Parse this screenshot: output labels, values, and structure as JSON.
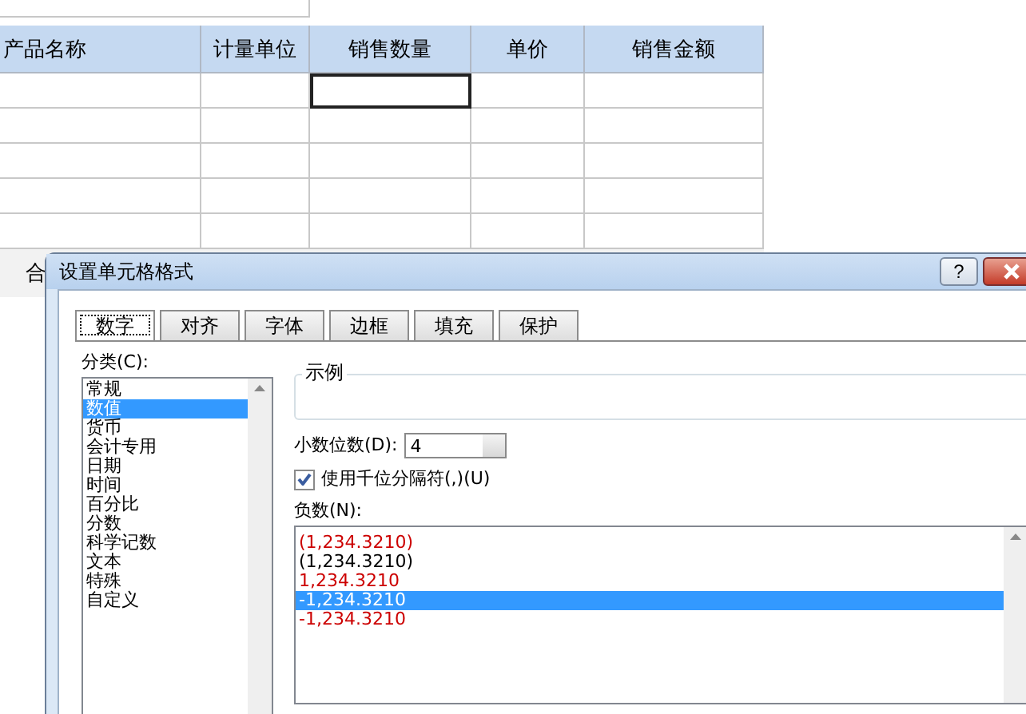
{
  "sheet": {
    "columns": [
      {
        "label": "产品名称"
      },
      {
        "label": "计量单位"
      },
      {
        "label": "销售数量"
      },
      {
        "label": "单价"
      },
      {
        "label": "销售金额"
      }
    ],
    "rows": [
      {
        "cells": [
          {
            "selected": false
          },
          {
            "selected": false
          },
          {
            "selected": true
          },
          {
            "selected": false
          },
          {
            "selected": false
          }
        ]
      },
      {
        "cells": [
          {
            "selected": false
          },
          {
            "selected": false
          },
          {
            "selected": false
          },
          {
            "selected": false
          },
          {
            "selected": false
          }
        ]
      },
      {
        "cells": [
          {
            "selected": false
          },
          {
            "selected": false
          },
          {
            "selected": false
          },
          {
            "selected": false
          },
          {
            "selected": false
          }
        ]
      },
      {
        "cells": [
          {
            "selected": false
          },
          {
            "selected": false
          },
          {
            "selected": false
          },
          {
            "selected": false
          },
          {
            "selected": false
          }
        ]
      },
      {
        "cells": [
          {
            "selected": false
          },
          {
            "selected": false
          },
          {
            "selected": false
          },
          {
            "selected": false
          },
          {
            "selected": false
          }
        ]
      }
    ],
    "total_label": "合"
  },
  "dialog": {
    "title": "设置单元格格式",
    "help": "?",
    "tabs": [
      {
        "label": "数字",
        "selected": true
      },
      {
        "label": "对齐",
        "selected": false
      },
      {
        "label": "字体",
        "selected": false
      },
      {
        "label": "边框",
        "selected": false
      },
      {
        "label": "填充",
        "selected": false
      },
      {
        "label": "保护",
        "selected": false
      }
    ],
    "category_label": "分类(C):",
    "categories": [
      {
        "label": "常规",
        "selected": false
      },
      {
        "label": "数值",
        "selected": true
      },
      {
        "label": "货币",
        "selected": false
      },
      {
        "label": "会计专用",
        "selected": false
      },
      {
        "label": "日期",
        "selected": false
      },
      {
        "label": "时间",
        "selected": false
      },
      {
        "label": "百分比",
        "selected": false
      },
      {
        "label": "分数",
        "selected": false
      },
      {
        "label": "科学记数",
        "selected": false
      },
      {
        "label": "文本",
        "selected": false
      },
      {
        "label": "特殊",
        "selected": false
      },
      {
        "label": "自定义",
        "selected": false
      }
    ],
    "sample_label": "示例",
    "decimals_label": "小数位数(D):",
    "decimals_value": "4",
    "separator": {
      "label": "使用千位分隔符(,)(U)",
      "checked": true
    },
    "negative_label": "负数(N):",
    "negatives": [
      {
        "label": "(1,234.3210)",
        "color": "#cc0000",
        "selected": false
      },
      {
        "label": "(1,234.3210)",
        "color": "#000000",
        "selected": false
      },
      {
        "label": "1,234.3210",
        "color": "#cc0000",
        "selected": false
      },
      {
        "label": "-1,234.3210",
        "selected": true
      },
      {
        "label": "-1,234.3210",
        "color": "#cc0000",
        "selected": false
      }
    ]
  }
}
